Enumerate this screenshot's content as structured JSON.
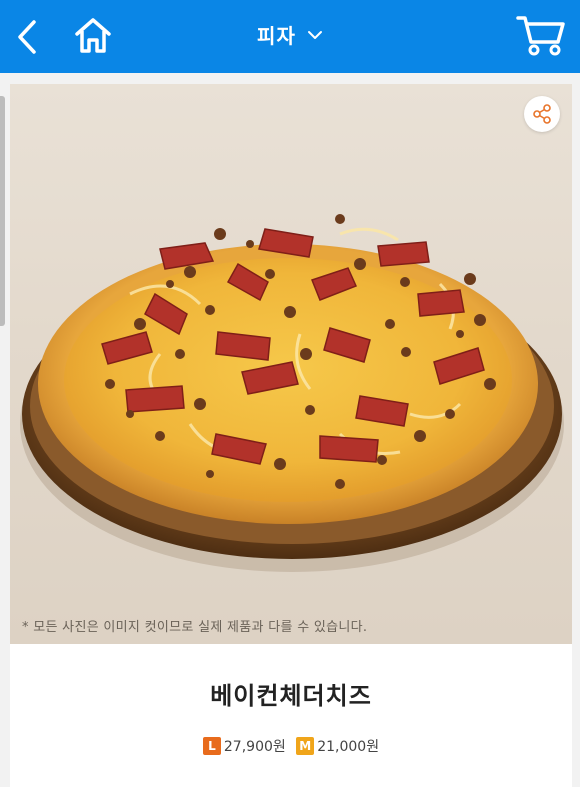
{
  "header": {
    "title": "피자",
    "background": "#0a86e6",
    "icons": [
      "chevron-left-icon",
      "home-icon",
      "chevron-down-icon",
      "cart-icon"
    ]
  },
  "hero": {
    "disclaimer": "* 모든 사진은 이미지 컷이므로 실제 제품과 다를 수 있습니다.",
    "share_icon": "share-icon"
  },
  "product": {
    "name": "베이컨체더치즈",
    "prices": [
      {
        "size": "L",
        "price": "27,900원",
        "color": "#e86b1c"
      },
      {
        "size": "M",
        "price": "21,000원",
        "color": "#f0a51a"
      }
    ]
  },
  "accent": {
    "share": "#e8742a"
  }
}
